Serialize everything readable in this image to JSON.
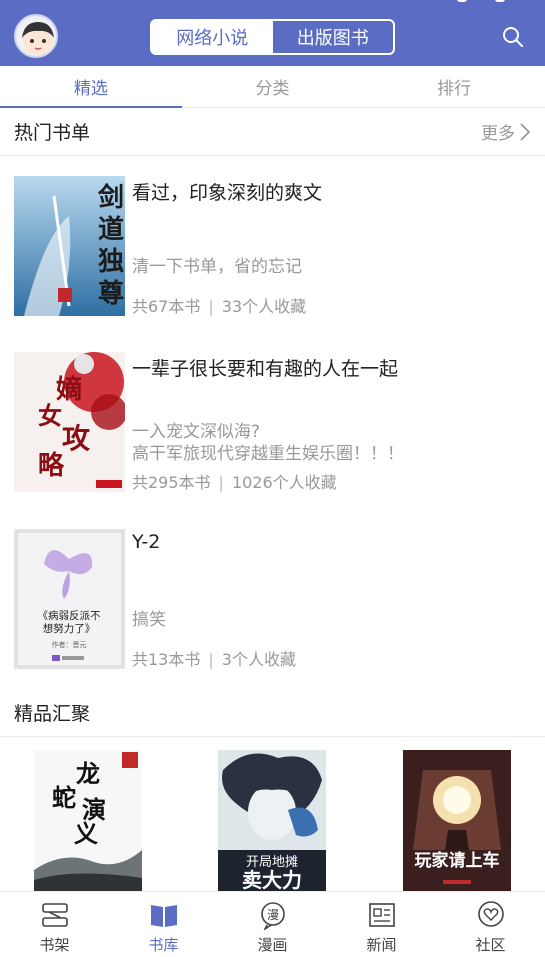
{
  "header": {
    "segments": [
      "网络小说",
      "出版图书"
    ],
    "active_segment": 0
  },
  "tabs": [
    "精选",
    "分类",
    "排行"
  ],
  "active_tab": 0,
  "hot_lists": {
    "title": "热门书单",
    "more_label": "更多",
    "items": [
      {
        "title": "看过，印象深刻的爽文",
        "desc": [
          "清一下书单，省的忘记"
        ],
        "count": "共67本书",
        "fav": "33个人收藏",
        "cover_text": "剑道独尊"
      },
      {
        "title": "一辈子很长要和有趣的人在一起",
        "desc": [
          "一入宠文深似海?",
          "高干军旅现代穿越重生娱乐圈！！！"
        ],
        "count": "共295本书",
        "fav": "1026个人收藏",
        "cover_text": "嫡女攻略"
      },
      {
        "title": "Y-2",
        "desc": [
          "搞笑"
        ],
        "count": "共13本书",
        "fav": "3个人收藏",
        "cover_text": "《病弱反派不想努力了》"
      }
    ]
  },
  "featured": {
    "title": "精品汇聚",
    "books": [
      {
        "cover_text": "龙蛇演义"
      },
      {
        "cover_text": "开局地摊卖大力"
      },
      {
        "cover_text": "玩家请上车"
      }
    ]
  },
  "bottom_nav": [
    "书架",
    "书库",
    "漫画",
    "新闻",
    "社区"
  ],
  "active_nav": 1,
  "colors": {
    "accent": "#5b6cc4",
    "muted": "#999999"
  }
}
